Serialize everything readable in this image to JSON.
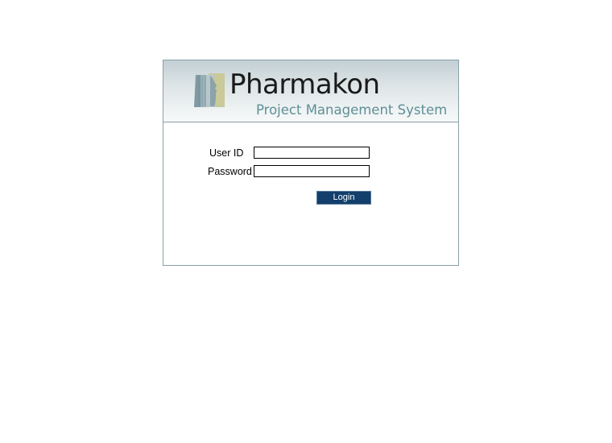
{
  "branding": {
    "name": "Pharmakon",
    "subtitle": "Project Management System",
    "logo_icon": "profile-faces-logo-icon"
  },
  "form": {
    "user_id_label": "User ID",
    "user_id_value": "",
    "password_label": "Password",
    "password_value": "",
    "login_label": "Login"
  },
  "colors": {
    "banner_top": "#c3cfd4",
    "banner_bottom": "#f7f9f9",
    "subtitle": "#5f8f97",
    "button_bg": "#123f6b",
    "border": "#8aa0a8"
  }
}
